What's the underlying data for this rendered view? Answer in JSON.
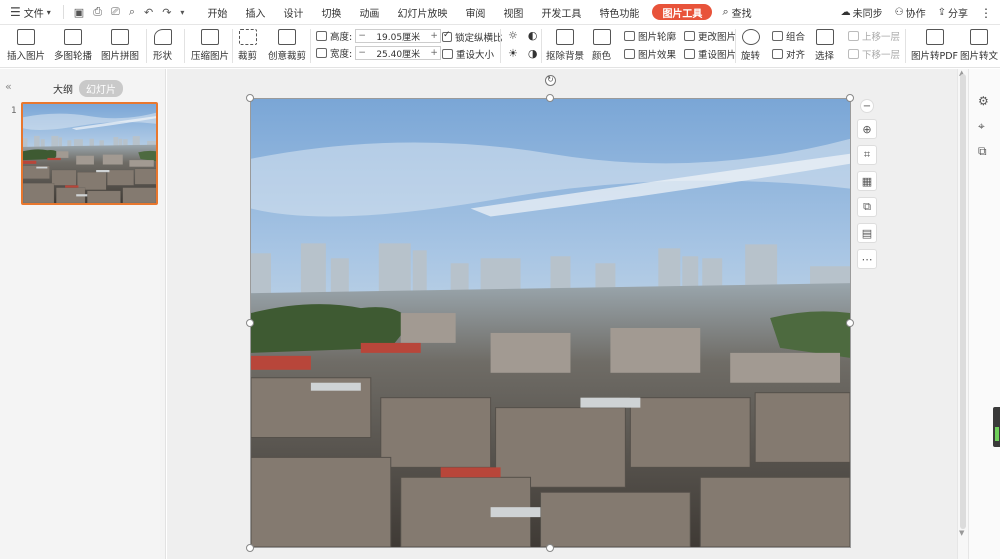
{
  "menubar": {
    "file_label": "文件",
    "tabs": [
      "开始",
      "插入",
      "设计",
      "切换",
      "动画",
      "幻灯片放映",
      "审阅",
      "视图",
      "开发工具",
      "特色功能"
    ],
    "active_tab": "图片工具",
    "search_label": "查找",
    "sync_label": "未同步",
    "collab_label": "协作",
    "share_label": "分享"
  },
  "ribbon": {
    "insert_picture": "插入图片",
    "multi_outline": "多图轮播",
    "picture_collage": "图片拼图",
    "shape": "形状",
    "compress": "压缩图片",
    "crop": "裁剪",
    "creative_crop": "创意裁剪",
    "height_label": "高度:",
    "height_value": "19.05厘米",
    "width_label": "宽度:",
    "width_value": "25.40厘米",
    "lock_ratio": "锁定纵横比",
    "reset_size": "重设大小",
    "remove_bg": "抠除背景",
    "color": "颜色",
    "picture_outline": "图片轮廓",
    "picture_effect": "图片效果",
    "change_picture": "更改图片",
    "reset_picture": "重设图片",
    "rotate": "旋转",
    "group": "组合",
    "align": "对齐",
    "select": "选择",
    "bring_forward": "上移一层",
    "send_backward": "下移一层",
    "to_pdf": "图片转PDF",
    "to_text": "图片转文"
  },
  "leftpanel": {
    "outline_tab": "大纲",
    "slides_tab": "幻灯片",
    "slide_number": "1"
  },
  "colors": {
    "accent": "#e8533a",
    "thumb_border": "#e8772e"
  }
}
